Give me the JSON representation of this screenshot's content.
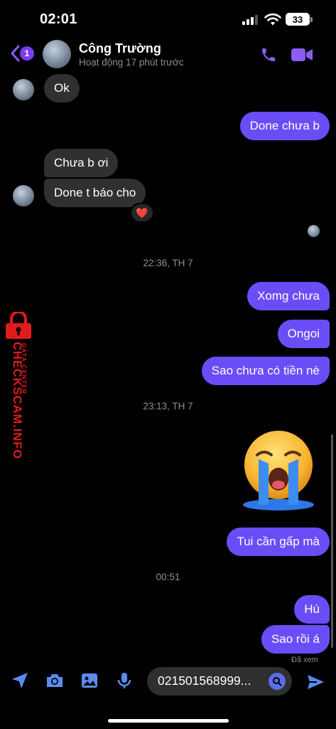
{
  "status_bar": {
    "time": "02:01",
    "battery": "33"
  },
  "header": {
    "back_badge": "1",
    "contact_name": "Công Trường",
    "contact_status": "Hoạt động 17 phút trước",
    "icons": [
      "back-icon",
      "phone-icon",
      "video-call-icon"
    ]
  },
  "messages": [
    {
      "side": "in",
      "text": "Ok"
    },
    {
      "side": "out",
      "text": "Done chưa b"
    },
    {
      "side": "in",
      "text": "Chưa b ơi"
    },
    {
      "side": "in",
      "text": "Done t báo cho",
      "reaction": "❤️"
    },
    {
      "side": "out",
      "text": "Xomg chưa"
    },
    {
      "side": "out",
      "text": "Ongoi"
    },
    {
      "side": "out",
      "text": "Sao chưa có tiền nè"
    },
    {
      "side": "out",
      "text": "Tui cần gấp mà"
    },
    {
      "side": "out",
      "text": "Hú"
    },
    {
      "side": "out",
      "text": "Sao rồi á"
    }
  ],
  "timestamps": [
    "22:36, TH 7",
    "23:13, TH 7",
    "00:51"
  ],
  "seen_label": "Đã xem",
  "watermark": {
    "main": "CHECKSCAM.INFO",
    "sub": "DATA CENTER"
  },
  "composer": {
    "input_value": "021501568999...",
    "icons": [
      "location-icon",
      "camera-icon",
      "gallery-icon",
      "microphone-icon",
      "search-icon",
      "send-icon"
    ]
  },
  "colors": {
    "accent": "#6b4df8",
    "incoming_bubble": "#303030",
    "watermark": "#e01b1b"
  }
}
